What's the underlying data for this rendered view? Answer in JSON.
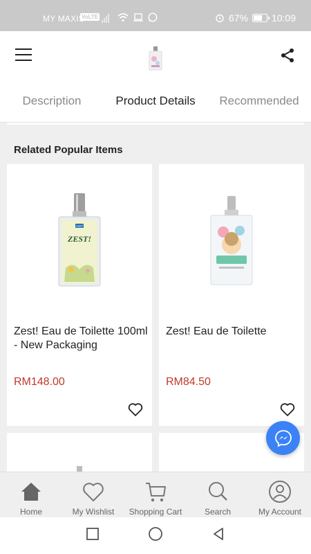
{
  "status_bar": {
    "carrier": "MY MAXIS",
    "volte": "VoLTE",
    "battery_pct": "67%",
    "battery_level": 0.67,
    "time": "10:09"
  },
  "header": {
    "logo_icon": "perfume-bottle-logo",
    "menu_icon": "hamburger-menu-icon",
    "share_icon": "share-icon"
  },
  "tabs": [
    {
      "label": "Description",
      "active": false
    },
    {
      "label": "Product Details",
      "active": true
    },
    {
      "label": "Recommended",
      "active": false
    }
  ],
  "section": {
    "title": "Related Popular Items"
  },
  "products": [
    {
      "name": "Zest! Eau de Toilette 100ml - New Packaging",
      "price": "RM148.00",
      "bottle_label": "ZEST!",
      "bottle_brand": "AGIT"
    },
    {
      "name": "Zest! Eau de Toilette",
      "price": "RM84.50"
    }
  ],
  "bottom_nav": [
    {
      "label": "Home",
      "icon": "home-icon"
    },
    {
      "label": "My Wishlist",
      "icon": "heart-icon"
    },
    {
      "label": "Shopping Cart",
      "icon": "cart-icon"
    },
    {
      "label": "Search",
      "icon": "search-icon"
    },
    {
      "label": "My Account",
      "icon": "account-icon"
    }
  ],
  "colors": {
    "price": "#c0392b",
    "fab": "#3b82f6",
    "status_bar": "#c9c9c9"
  }
}
